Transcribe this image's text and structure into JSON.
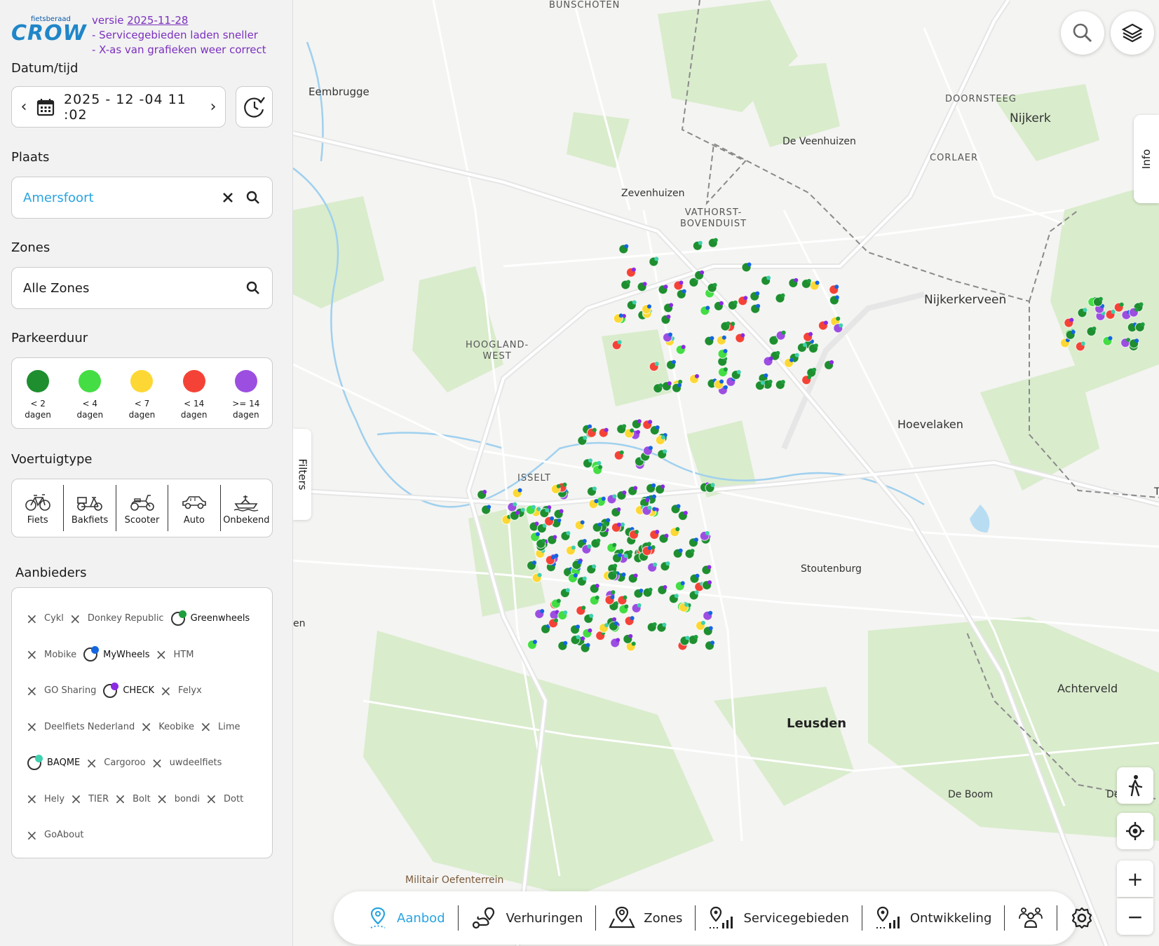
{
  "sidebar": {
    "logo": {
      "small": "fietsberaad",
      "big": "CROW"
    },
    "version": {
      "prefix": "versie ",
      "date": "2025-11-28",
      "notes": [
        "- Servicegebieden laden sneller",
        "- X-as van grafieken weer correct"
      ]
    },
    "datetime": {
      "label": "Datum/tijd",
      "value": "2025 - 12 -04   11 :02",
      "prev": "‹",
      "next": "›"
    },
    "place": {
      "label": "Plaats",
      "value": "Amersfoort"
    },
    "zones": {
      "label": "Zones",
      "value": "Alle Zones"
    },
    "parking": {
      "label": "Parkeerduur",
      "items": [
        {
          "line1": "< 2",
          "line2": "dagen",
          "color": "#1e8e2e"
        },
        {
          "line1": "< 4",
          "line2": "dagen",
          "color": "#44dd44"
        },
        {
          "line1": "< 7",
          "line2": "dagen",
          "color": "#fdd835"
        },
        {
          "line1": "< 14",
          "line2": "dagen",
          "color": "#f44336"
        },
        {
          "line1": ">= 14",
          "line2": "dagen",
          "color": "#9c4ee0"
        }
      ]
    },
    "vehicle": {
      "label": "Voertuigtype",
      "items": [
        {
          "label": "Fiets",
          "icon": "bicycle-icon"
        },
        {
          "label": "Bakfiets",
          "icon": "cargo-bike-icon"
        },
        {
          "label": "Scooter",
          "icon": "scooter-icon"
        },
        {
          "label": "Auto",
          "icon": "car-icon"
        },
        {
          "label": "Onbekend",
          "icon": "unknown-vehicle-icon"
        }
      ]
    },
    "providers": {
      "label": "Aanbieders",
      "rows": [
        [
          {
            "name": "Cykl",
            "on": false
          },
          {
            "name": "Donkey Republic",
            "on": false
          },
          {
            "name": "Greenwheels",
            "on": true,
            "color": "#1e9e3e"
          }
        ],
        [
          {
            "name": "Mobike",
            "on": false
          },
          {
            "name": "MyWheels",
            "on": true,
            "color": "#1565e0"
          },
          {
            "name": "HTM",
            "on": false
          }
        ],
        [
          {
            "name": "GO Sharing",
            "on": false
          },
          {
            "name": "CHECK",
            "on": true,
            "color": "#8a2be2"
          },
          {
            "name": "Felyx",
            "on": false
          }
        ],
        [
          {
            "name": "Deelfiets Nederland",
            "on": false
          },
          {
            "name": "Keobike",
            "on": false
          },
          {
            "name": "Lime",
            "on": false
          }
        ],
        [
          {
            "name": "BAQME",
            "on": true,
            "color": "#3fd0b0"
          },
          {
            "name": "Cargoroo",
            "on": false
          },
          {
            "name": "uwdeelfiets",
            "on": false
          }
        ],
        [
          {
            "name": "Hely",
            "on": false
          },
          {
            "name": "TIER",
            "on": false
          },
          {
            "name": "Bolt",
            "on": false
          },
          {
            "name": "bondi",
            "on": false
          },
          {
            "name": "Dott",
            "on": false
          }
        ],
        [
          {
            "name": "GoAbout",
            "on": false
          }
        ]
      ]
    }
  },
  "map": {
    "places": [
      {
        "text": "BUNSCHOTEN",
        "cls": "caps"
      },
      {
        "text": "Eembrugge",
        "cls": ""
      },
      {
        "text": "DOORNSTEEG",
        "cls": "caps"
      },
      {
        "text": "Nijkerk",
        "cls": ""
      },
      {
        "text": "De Veenhuizen",
        "cls": ""
      },
      {
        "text": "CORLAER",
        "cls": "caps"
      },
      {
        "text": "Zevenhuizen",
        "cls": ""
      },
      {
        "text": "VATHORST-\nBOVENDUIST",
        "cls": "caps"
      },
      {
        "text": "Nijkerkerveen",
        "cls": ""
      },
      {
        "text": "HOOGLAND-\nWEST",
        "cls": "caps"
      },
      {
        "text": "Hoevelaken",
        "cls": ""
      },
      {
        "text": "ISSELT",
        "cls": "caps"
      },
      {
        "text": "Stoutenburg",
        "cls": ""
      },
      {
        "text": "en",
        "cls": ""
      },
      {
        "text": "Achterveld",
        "cls": ""
      },
      {
        "text": "Leusden",
        "cls": "big"
      },
      {
        "text": "De Boom",
        "cls": ""
      },
      {
        "text": "De",
        "cls": ""
      },
      {
        "text": "Militair Oefenterrein",
        "cls": ""
      },
      {
        "text": "T",
        "cls": ""
      }
    ],
    "info_tab": "Info",
    "filters_tab": "Filters",
    "nav": [
      {
        "label": "Aanbod",
        "active": true
      },
      {
        "label": "Verhuringen",
        "active": false
      },
      {
        "label": "Zones",
        "active": false
      },
      {
        "label": "Servicegebieden",
        "active": false
      },
      {
        "label": "Ontwikkeling",
        "active": false
      },
      {
        "label": "",
        "active": false
      },
      {
        "label": "",
        "active": false
      }
    ],
    "zoom_in": "+",
    "zoom_out": "−"
  }
}
